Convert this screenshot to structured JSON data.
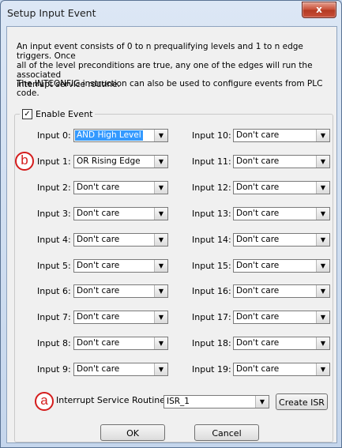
{
  "window": {
    "title": "Setup Input Event",
    "close_glyph": "x"
  },
  "description": {
    "line1": "An input event consists of 0 to n prequalifying levels and 1 to n edge triggers. Once",
    "line2": "all of the level preconditions are true, any one of the edges will run the associated",
    "line3": "interrupt service routine.",
    "line4": "The INTCONFIG instruction can also be used to configure events from PLC code."
  },
  "enable_event": {
    "label": "Enable Event",
    "checked": true,
    "check_glyph": "✓"
  },
  "inputs": [
    {
      "label": "Input 0:",
      "value": "AND High Level"
    },
    {
      "label": "Input 1:",
      "value": "OR Rising Edge"
    },
    {
      "label": "Input 2:",
      "value": "Don't care"
    },
    {
      "label": "Input 3:",
      "value": "Don't care"
    },
    {
      "label": "Input 4:",
      "value": "Don't care"
    },
    {
      "label": "Input 5:",
      "value": "Don't care"
    },
    {
      "label": "Input 6:",
      "value": "Don't care"
    },
    {
      "label": "Input 7:",
      "value": "Don't care"
    },
    {
      "label": "Input 8:",
      "value": "Don't care"
    },
    {
      "label": "Input 9:",
      "value": "Don't care"
    },
    {
      "label": "Input 10:",
      "value": "Don't care"
    },
    {
      "label": "Input 11:",
      "value": "Don't care"
    },
    {
      "label": "Input 12:",
      "value": "Don't care"
    },
    {
      "label": "Input 13:",
      "value": "Don't care"
    },
    {
      "label": "Input 14:",
      "value": "Don't care"
    },
    {
      "label": "Input 15:",
      "value": "Don't care"
    },
    {
      "label": "Input 16:",
      "value": "Don't care"
    },
    {
      "label": "Input 17:",
      "value": "Don't care"
    },
    {
      "label": "Input 18:",
      "value": "Don't care"
    },
    {
      "label": "Input 19:",
      "value": "Don't care"
    }
  ],
  "isr": {
    "label": "Interrupt Service Routine:",
    "value": "ISR_1",
    "create_label": "Create ISR"
  },
  "callouts": {
    "a": "a",
    "b": "b",
    "color": "#d41c1c"
  },
  "buttons": {
    "ok": "OK",
    "cancel": "Cancel"
  },
  "icons": {
    "dropdown": "chevron-down-icon",
    "close": "close-icon",
    "check": "check-icon"
  }
}
